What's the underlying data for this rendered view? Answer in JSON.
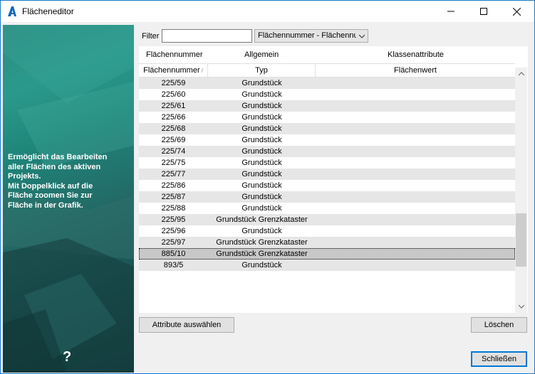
{
  "window": {
    "title": "Flächeneditor",
    "app_icon": "autocad-a-icon",
    "accent": "#1979ca"
  },
  "side_panel": {
    "description": "Ermöglicht das Bearbeiten\naller Flächen des aktiven\nProjekts.\nMit Doppelklick auf die\nFläche zoomen Sie zur\nFläche in der Grafik.",
    "help_label": "?"
  },
  "filter": {
    "label": "Filter",
    "value": "",
    "select_value": "Flächennummer - Flächennummer"
  },
  "grid": {
    "group_headers": [
      "Flächennummer",
      "Allgemein",
      "Klassenattribute"
    ],
    "columns": [
      "Flächennummer",
      "Typ",
      "Flächenwert"
    ],
    "rows": [
      {
        "nr": "225/59",
        "typ": "Grundstück",
        "wert": ""
      },
      {
        "nr": "225/60",
        "typ": "Grundstück",
        "wert": ""
      },
      {
        "nr": "225/61",
        "typ": "Grundstück",
        "wert": ""
      },
      {
        "nr": "225/66",
        "typ": "Grundstück",
        "wert": ""
      },
      {
        "nr": "225/68",
        "typ": "Grundstück",
        "wert": ""
      },
      {
        "nr": "225/69",
        "typ": "Grundstück",
        "wert": ""
      },
      {
        "nr": "225/74",
        "typ": "Grundstück",
        "wert": ""
      },
      {
        "nr": "225/75",
        "typ": "Grundstück",
        "wert": ""
      },
      {
        "nr": "225/77",
        "typ": "Grundstück",
        "wert": ""
      },
      {
        "nr": "225/86",
        "typ": "Grundstück",
        "wert": ""
      },
      {
        "nr": "225/87",
        "typ": "Grundstück",
        "wert": ""
      },
      {
        "nr": "225/88",
        "typ": "Grundstück",
        "wert": ""
      },
      {
        "nr": "225/95",
        "typ": "Grundstück Grenzkataster",
        "wert": ""
      },
      {
        "nr": "225/96",
        "typ": "Grundstück",
        "wert": ""
      },
      {
        "nr": "225/97",
        "typ": "Grundstück Grenzkataster",
        "wert": ""
      },
      {
        "nr": "885/10",
        "typ": "Grundstück Grenzkataster",
        "wert": "",
        "selected": true
      },
      {
        "nr": "893/5",
        "typ": "Grundstück",
        "wert": ""
      }
    ]
  },
  "buttons": {
    "select_attributes": "Attribute auswählen",
    "delete": "Löschen",
    "close": "Schließen"
  }
}
